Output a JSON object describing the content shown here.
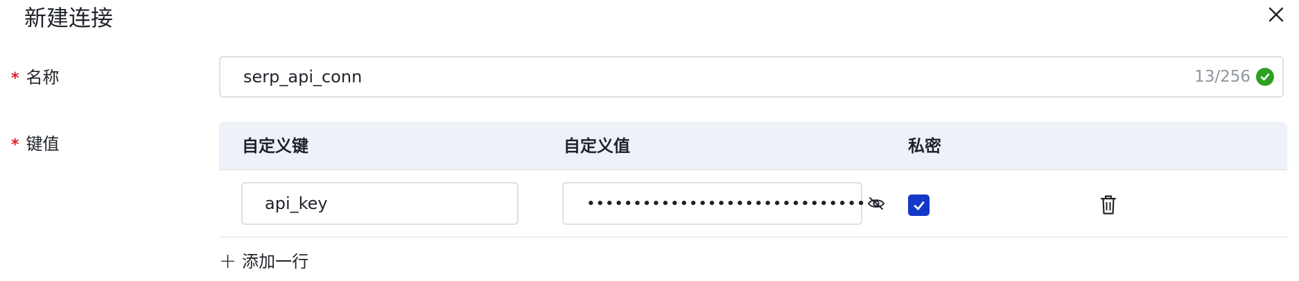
{
  "dialog": {
    "title": "新建连接"
  },
  "form": {
    "name": {
      "required_mark": "*",
      "label": "名称",
      "value": "serp_api_conn",
      "counter": "13/256"
    },
    "kv": {
      "required_mark": "*",
      "label": "键值",
      "headers": {
        "key": "自定义键",
        "value": "自定义值",
        "secret": "私密"
      },
      "rows": [
        {
          "key": "api_key",
          "value_masked": "••••••••••••••••••••••••••••••",
          "secret": true
        }
      ],
      "add_row_label": "添加一行"
    }
  },
  "colors": {
    "required": "#e0202b",
    "valid": "#2ea121",
    "checkbox": "#1438c8",
    "header_bg": "#eef1f8"
  },
  "icons": {
    "close": "close-icon",
    "valid": "check-circle-icon",
    "toggle_visibility": "eye-off-icon",
    "checkbox": "checkmark-icon",
    "delete": "trash-icon",
    "add": "plus-icon"
  }
}
